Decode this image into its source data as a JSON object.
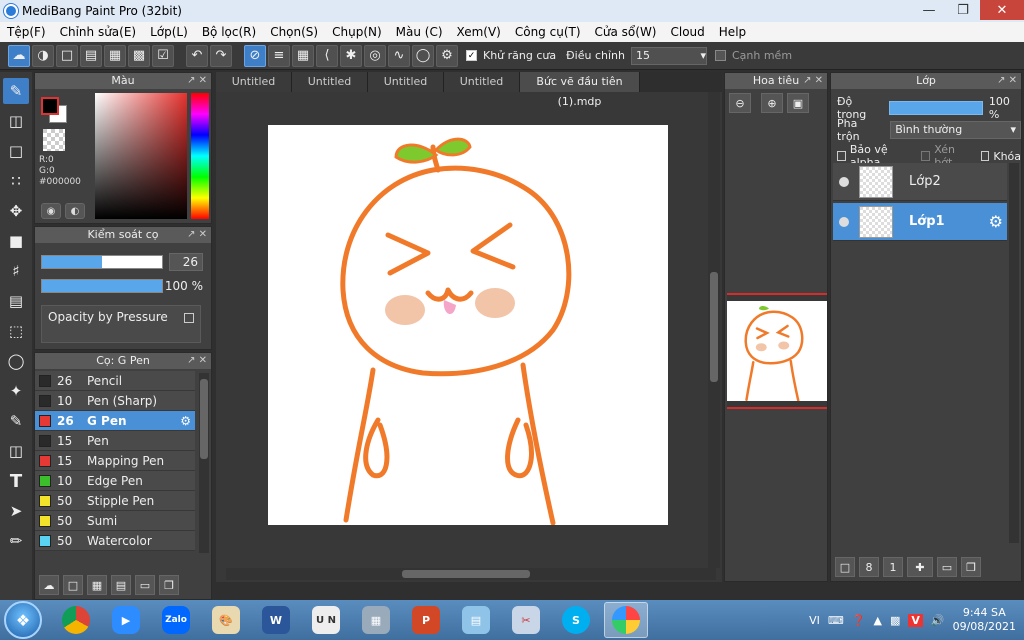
{
  "window": {
    "title": "MediBang Paint Pro (32bit)"
  },
  "menu": [
    "Tệp(F)",
    "Chỉnh sửa(E)",
    "Lớp(L)",
    "Bộ lọc(R)",
    "Chọn(S)",
    "Chụp(N)",
    "Màu (C)",
    "Xem(V)",
    "Công cụ(T)",
    "Cửa sổ(W)",
    "Cloud",
    "Help"
  ],
  "toolbar": {
    "antialias_label": "Khử răng cưa",
    "adjust_label": "Điều chỉnh",
    "adjust_value": "15",
    "smooth_label": "Cạnh mềm"
  },
  "color_panel": {
    "title": "Màu",
    "r": "R:0",
    "g": "G:0",
    "hex": "#000000"
  },
  "brush_control": {
    "title": "Kiểm soát cọ",
    "size": "26",
    "opacity": "100 %",
    "pressure_label": "Opacity by Pressure",
    "size_fill": 0.5,
    "opacity_fill": 1.0
  },
  "brush_panel": {
    "title": "Cọ: G Pen",
    "items": [
      {
        "size": "26",
        "name": "Pencil",
        "color": "#2a2a2a",
        "active": false
      },
      {
        "size": "10",
        "name": "Pen (Sharp)",
        "color": "#2a2a2a",
        "active": false
      },
      {
        "size": "26",
        "name": "G Pen",
        "color": "#e53935",
        "active": true
      },
      {
        "size": "15",
        "name": "Pen",
        "color": "#2a2a2a",
        "active": false
      },
      {
        "size": "15",
        "name": "Mapping Pen",
        "color": "#e53935",
        "active": false
      },
      {
        "size": "10",
        "name": "Edge Pen",
        "color": "#3bbf2a",
        "active": false
      },
      {
        "size": "50",
        "name": "Stipple Pen",
        "color": "#f2e22a",
        "active": false
      },
      {
        "size": "50",
        "name": "Sumi",
        "color": "#f2e22a",
        "active": false
      },
      {
        "size": "50",
        "name": "Watercolor",
        "color": "#5ad2f2",
        "active": false
      }
    ]
  },
  "tabs": [
    "Untitled",
    "Untitled",
    "Untitled",
    "Untitled",
    "Bức vẽ đầu tiên (1).mdp"
  ],
  "navigator": {
    "title": "Hoa tiêu"
  },
  "layer_panel": {
    "title": "Lớp",
    "opacity_label": "Độ trong",
    "opacity_value": "100 %",
    "blend_label": "Pha trộn",
    "blend_value": "Bình thường",
    "protect_alpha": "Bảo vệ alpha",
    "clipping": "Xén bớt",
    "lock": "Khóa",
    "layers": [
      {
        "name": "Lớp2",
        "active": false
      },
      {
        "name": "Lớp1",
        "active": true
      }
    ]
  },
  "taskbar": {
    "apps": [
      "chrome",
      "zoom",
      "zalo",
      "paint",
      "word",
      "ime",
      "calculator",
      "powerpoint",
      "notepad",
      "snipping",
      "skype",
      "medibang"
    ],
    "lang": "VI",
    "time": "9:44 SA",
    "date": "09/08/2021"
  },
  "colors": {
    "accent": "#4a90d6",
    "drawing": "#f07a2a"
  }
}
